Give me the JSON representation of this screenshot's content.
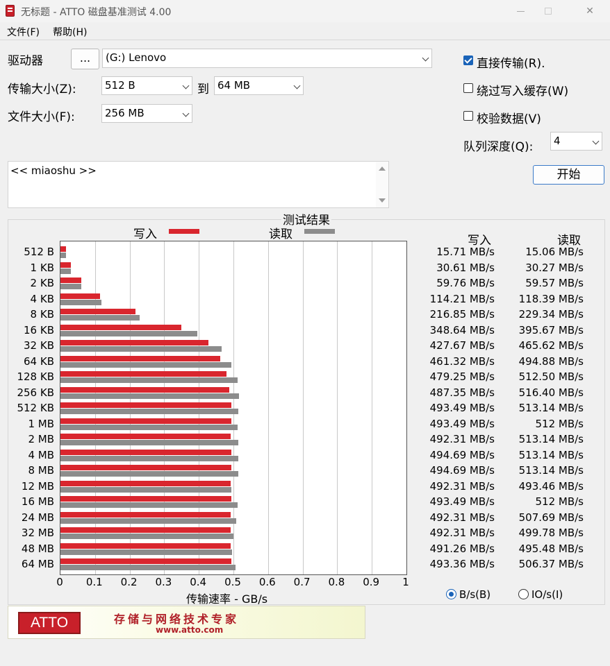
{
  "window": {
    "title": "无标题 - ATTO 磁盘基准测试 4.00",
    "close_glyph": "✕"
  },
  "menu": {
    "file": "文件(F)",
    "help": "帮助(H)"
  },
  "form": {
    "drive_label": "驱动器",
    "browse_label": "...",
    "drive_value": "(G:) Lenovo",
    "transfer_size_label": "传输大小(Z):",
    "transfer_min": "512 B",
    "to_label": "到",
    "transfer_max": "64 MB",
    "file_size_label": "文件大小(F):",
    "file_size": "256 MB",
    "direct_io_label": "直接传输(R).",
    "direct_io_checked": true,
    "bypass_cache_label": "绕过写入缓存(W)",
    "bypass_cache_checked": false,
    "verify_label": "校验数据(V)",
    "verify_checked": false,
    "queue_depth_label": "队列深度(Q):",
    "queue_depth": "4",
    "start_label": "开始"
  },
  "description": {
    "text": "<< miaoshu >>"
  },
  "results": {
    "title": "测试结果",
    "legend_write": "写入",
    "legend_read": "读取",
    "col_write": "写入",
    "col_read": "读取",
    "x_axis_title": "传输速率 - GB/s",
    "write_color": "#d9262e",
    "read_color": "#8c8c8c",
    "rows": [
      {
        "size": "512 B",
        "write": "15.71 MB/s",
        "read": "15.06 MB/s"
      },
      {
        "size": "1 KB",
        "write": "30.61 MB/s",
        "read": "30.27 MB/s"
      },
      {
        "size": "2 KB",
        "write": "59.76 MB/s",
        "read": "59.57 MB/s"
      },
      {
        "size": "4 KB",
        "write": "114.21 MB/s",
        "read": "118.39 MB/s"
      },
      {
        "size": "8 KB",
        "write": "216.85 MB/s",
        "read": "229.34 MB/s"
      },
      {
        "size": "16 KB",
        "write": "348.64 MB/s",
        "read": "395.67 MB/s"
      },
      {
        "size": "32 KB",
        "write": "427.67 MB/s",
        "read": "465.62 MB/s"
      },
      {
        "size": "64 KB",
        "write": "461.32 MB/s",
        "read": "494.88 MB/s"
      },
      {
        "size": "128 KB",
        "write": "479.25 MB/s",
        "read": "512.50 MB/s"
      },
      {
        "size": "256 KB",
        "write": "487.35 MB/s",
        "read": "516.40 MB/s"
      },
      {
        "size": "512 KB",
        "write": "493.49 MB/s",
        "read": "513.14 MB/s"
      },
      {
        "size": "1 MB",
        "write": "493.49 MB/s",
        "read": "512 MB/s"
      },
      {
        "size": "2 MB",
        "write": "492.31 MB/s",
        "read": "513.14 MB/s"
      },
      {
        "size": "4 MB",
        "write": "494.69 MB/s",
        "read": "513.14 MB/s"
      },
      {
        "size": "8 MB",
        "write": "494.69 MB/s",
        "read": "513.14 MB/s"
      },
      {
        "size": "12 MB",
        "write": "492.31 MB/s",
        "read": "493.46 MB/s"
      },
      {
        "size": "16 MB",
        "write": "493.49 MB/s",
        "read": "512 MB/s"
      },
      {
        "size": "24 MB",
        "write": "492.31 MB/s",
        "read": "507.69 MB/s"
      },
      {
        "size": "32 MB",
        "write": "492.31 MB/s",
        "read": "499.78 MB/s"
      },
      {
        "size": "48 MB",
        "write": "491.26 MB/s",
        "read": "495.48 MB/s"
      },
      {
        "size": "64 MB",
        "write": "493.36 MB/s",
        "read": "506.37 MB/s"
      }
    ],
    "unit_bytes_label": "B/s(B)",
    "unit_bytes_selected": true,
    "unit_io_label": "IO/s(I)"
  },
  "chart_data": {
    "type": "bar",
    "orientation": "horizontal",
    "xlabel": "传输速率 - GB/s",
    "xlim": [
      0,
      1
    ],
    "x_ticks": [
      "0",
      "0.1",
      "0.2",
      "0.3",
      "0.4",
      "0.5",
      "0.6",
      "0.7",
      "0.8",
      "0.9",
      "1"
    ],
    "categories": [
      "512 B",
      "1 KB",
      "2 KB",
      "4 KB",
      "8 KB",
      "16 KB",
      "32 KB",
      "64 KB",
      "128 KB",
      "256 KB",
      "512 KB",
      "1 MB",
      "2 MB",
      "4 MB",
      "8 MB",
      "12 MB",
      "16 MB",
      "24 MB",
      "32 MB",
      "48 MB",
      "64 MB"
    ],
    "series": [
      {
        "name": "写入",
        "values": [
          0.0157,
          0.0306,
          0.0598,
          0.1142,
          0.2169,
          0.3486,
          0.4277,
          0.4613,
          0.4793,
          0.4874,
          0.4935,
          0.4935,
          0.4923,
          0.4947,
          0.4947,
          0.4923,
          0.4935,
          0.4923,
          0.4923,
          0.4913,
          0.4934
        ]
      },
      {
        "name": "读取",
        "values": [
          0.0151,
          0.0303,
          0.0596,
          0.1184,
          0.2293,
          0.3957,
          0.4656,
          0.4949,
          0.5125,
          0.5164,
          0.5131,
          0.512,
          0.5131,
          0.5131,
          0.5131,
          0.4935,
          0.512,
          0.5077,
          0.4998,
          0.4955,
          0.5064
        ]
      }
    ],
    "grid": true,
    "legend": "top"
  },
  "banner": {
    "logo_text": "ATTO",
    "slogan": "存储与网络技术专家",
    "url": "www.atto.com"
  }
}
